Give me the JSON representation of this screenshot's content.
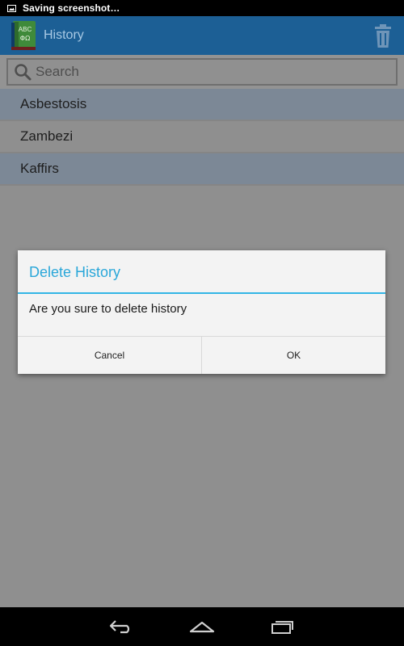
{
  "status_bar": {
    "text": "Saving screenshot…",
    "icon": "image-icon"
  },
  "action_bar": {
    "title": "History",
    "logo_text_top": "ABC",
    "logo_text_bottom": "ΦΩ",
    "logo_icon": "dictionary-book-icon",
    "delete_icon": "trash-icon"
  },
  "search": {
    "placeholder": "Search",
    "value": "",
    "icon": "search-icon"
  },
  "history": {
    "items": [
      {
        "label": "Asbestosis"
      },
      {
        "label": "Zambezi"
      },
      {
        "label": "Kaffirs"
      }
    ]
  },
  "dialog": {
    "title": "Delete History",
    "message": "Are you sure to delete history",
    "cancel_label": "Cancel",
    "ok_label": "OK"
  },
  "nav_bar": {
    "back_icon": "back-icon",
    "home_icon": "home-icon",
    "recents_icon": "recents-icon"
  },
  "colors": {
    "action_bar": "#1c5f95",
    "dialog_accent": "#33b5e5",
    "scrim": "#8f8f8f"
  }
}
